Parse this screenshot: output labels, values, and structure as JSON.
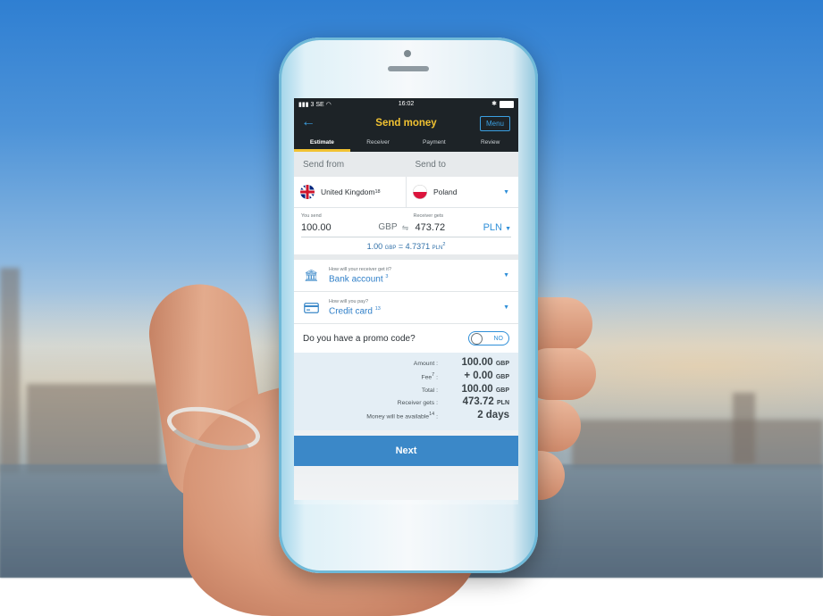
{
  "status_bar": {
    "carrier": "3 SE",
    "time": "16:02",
    "bluetooth": "✱"
  },
  "header": {
    "title": "Send money",
    "menu_label": "Menu"
  },
  "tabs": [
    {
      "label": "Estimate",
      "active": true
    },
    {
      "label": "Receiver",
      "active": false
    },
    {
      "label": "Payment",
      "active": false
    },
    {
      "label": "Review",
      "active": false
    }
  ],
  "countries": {
    "send_from_label": "Send from",
    "send_to_label": "Send to",
    "from_country": "United Kingdom",
    "from_note": "18",
    "to_country": "Poland"
  },
  "amounts": {
    "you_send_label": "You send",
    "receiver_gets_label": "Receiver gets",
    "send_value": "100.00",
    "send_currency": "GBP",
    "receive_value": "473.72",
    "receive_currency": "PLN",
    "rate_base": "1.00",
    "rate_base_currency": "GBP",
    "rate_value": "= 4.7371",
    "rate_currency": "PLN",
    "rate_note": "2"
  },
  "delivery": {
    "question": "How will your receiver get it?",
    "value": "Bank account",
    "note": "3"
  },
  "payment": {
    "question": "How will you pay?",
    "value": "Credit card",
    "note": "13"
  },
  "promo": {
    "question": "Do you have a promo code?",
    "toggle_label": "NO"
  },
  "summary": [
    {
      "label": "Amount :",
      "value": "100.00",
      "unit": "GBP",
      "note": ""
    },
    {
      "label": "Fee",
      "note": "7",
      "label_tail": " :",
      "value": "+ 0.00",
      "unit": "GBP"
    },
    {
      "label": "Total :",
      "value": "100.00",
      "unit": "GBP",
      "note": ""
    },
    {
      "label": "Receiver gets :",
      "value": "473.72",
      "unit": "PLN",
      "note": ""
    },
    {
      "label": "Money will be available",
      "note": "14",
      "label_tail": " :",
      "value": "2 days",
      "unit": ""
    }
  ],
  "next_button": "Next",
  "colors": {
    "accent": "#3b88c8",
    "title_yellow": "#f1c232",
    "dark_bar": "#1d2327"
  }
}
